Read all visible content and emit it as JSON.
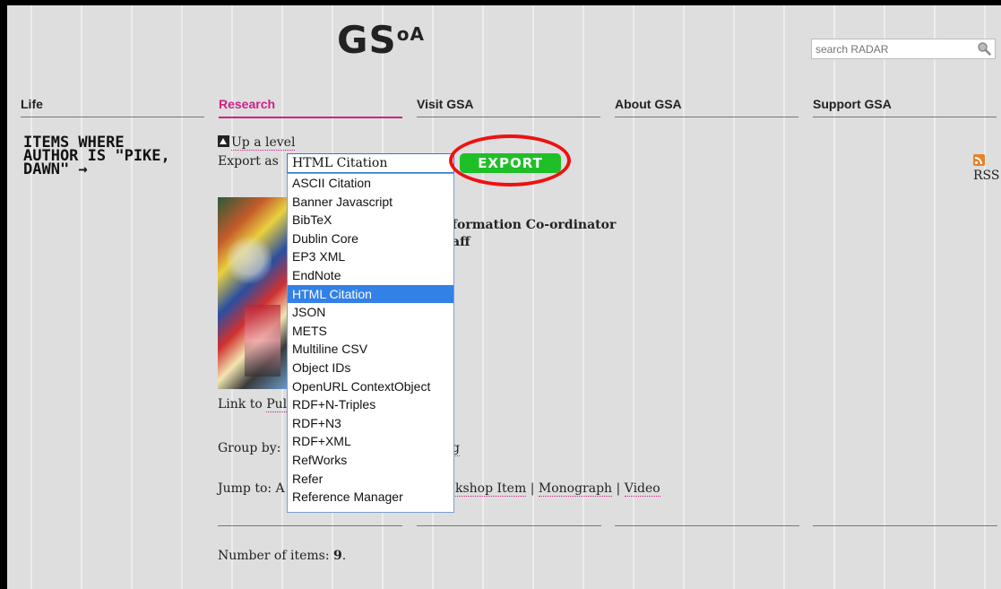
{
  "logo": {
    "text": "GS",
    "suffix": "oA"
  },
  "search": {
    "placeholder": "search RADAR"
  },
  "nav": {
    "items": [
      "Life",
      "Research",
      "Visit GSA",
      "About GSA",
      "Support GSA"
    ]
  },
  "sidebar": {
    "heading": "Items where Author is \"Pike, Dawn\" →"
  },
  "content": {
    "up_level": "Up a level",
    "export_label": "Export as",
    "selected_format": "HTML Citation",
    "export_button": "EXPORT",
    "rss": "RSS",
    "title_line1": "formation Co-ordinator",
    "title_line2": "aff",
    "link_to_pub_prefix": "Link to ",
    "link_to_pub": "Pul",
    "group_by": "Group by: ",
    "group_by_tail": "g",
    "jump_to": "Jump to: A",
    "jump_items": [
      "kshop Item",
      "Monograph",
      "Video"
    ],
    "number_of_items_label": "Number of items: ",
    "number_of_items": "9",
    "number_of_items_end": "."
  },
  "dropdown": {
    "options": [
      "ASCII Citation",
      "Banner Javascript",
      "BibTeX",
      "Dublin Core",
      "EP3 XML",
      "EndNote",
      "HTML Citation",
      "JSON",
      "METS",
      "Multiline CSV",
      "Object IDs",
      "OpenURL ContextObject",
      "RDF+N-Triples",
      "RDF+N3",
      "RDF+XML",
      "RefWorks",
      "Refer",
      "Reference Manager"
    ],
    "selected_index": 6
  },
  "colors": {
    "accent": "#cc2288",
    "export_green": "#1fbf28",
    "highlight_red": "#ee1111",
    "selection_blue": "#3281e6"
  }
}
